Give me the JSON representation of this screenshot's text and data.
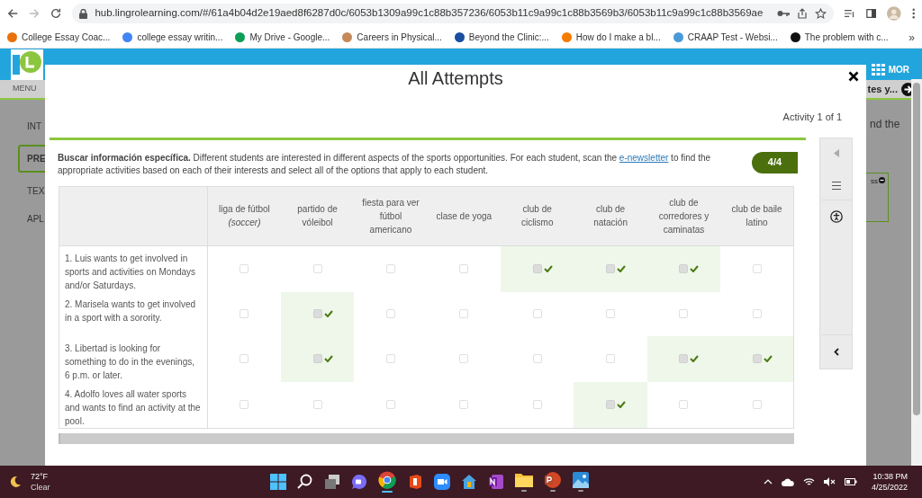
{
  "browser": {
    "url": "hub.lingrolearning.com/#/61a4b04d2e19aed8f6287d0c/6053b1309a99c1c88b357236/6053b11c9a99c1c88b3569b3/6053b11c9a99c1c88b3569ae",
    "bookmarks": [
      "College Essay Coac...",
      "college essay writin...",
      "My Drive - Google...",
      "Careers in Physical...",
      "Beyond the Clinic:...",
      "How do I make a bl...",
      "CRAAP Test - Websi...",
      "The problem with c..."
    ],
    "more": "»"
  },
  "app": {
    "menu": "MENU",
    "nav_right": "MOR",
    "breadcrumb": "tes y...",
    "content_text": "nd the",
    "panel_text": "ss",
    "sidebar_items": [
      {
        "label": "INT",
        "selected": false
      },
      {
        "label": "PRE",
        "selected": true
      },
      {
        "label": "TEX",
        "selected": false
      },
      {
        "label": "APL",
        "selected": false
      }
    ]
  },
  "modal": {
    "title": "All Attempts",
    "activity": "Activity 1 of 1",
    "instruction": {
      "lead": "Buscar información específica.",
      "before": "Different students are interested in different aspects of the sports opportunities. For each student, scan the",
      "link": "e-newsletter",
      "after": "to find the appropriate activities based on each of their interests and select all of the options that apply to each student."
    },
    "score": "4/4",
    "table": {
      "columns": [
        "liga de fútbol *(soccer)*",
        "partido de vóleibol",
        "fiesta para ver fútbol americano",
        "clase de yoga",
        "club de ciclismo",
        "club de natación",
        "club de corredores y caminatas",
        "club de baile latino"
      ],
      "rows": [
        {
          "label": "1. Luis wants to get involved in sports and activities on Mondays and/or Saturdays.",
          "cells": [
            {
              "checked": false
            },
            {
              "checked": false
            },
            {
              "checked": false
            },
            {
              "checked": false
            },
            {
              "checked": true
            },
            {
              "checked": true
            },
            {
              "checked": true
            },
            {
              "checked": false
            }
          ]
        },
        {
          "label": "2. Marisela wants to get involved in a sport with a sorority.",
          "cells": [
            {
              "checked": false
            },
            {
              "checked": true
            },
            {
              "checked": false
            },
            {
              "checked": false
            },
            {
              "checked": false
            },
            {
              "checked": false
            },
            {
              "checked": false
            },
            {
              "checked": false
            }
          ]
        },
        {
          "label": "3. Libertad is looking for something to do in the evenings, 6 p.m. or later.",
          "cells": [
            {
              "checked": false
            },
            {
              "checked": true
            },
            {
              "checked": false
            },
            {
              "checked": false
            },
            {
              "checked": false
            },
            {
              "checked": false
            },
            {
              "checked": true
            },
            {
              "checked": true
            }
          ]
        },
        {
          "label": "4. Adolfo loves all water sports and wants to find an activity at the pool.",
          "cells": [
            {
              "checked": false
            },
            {
              "checked": false
            },
            {
              "checked": false
            },
            {
              "checked": false
            },
            {
              "checked": false
            },
            {
              "checked": true
            },
            {
              "checked": false
            },
            {
              "checked": false
            }
          ]
        }
      ]
    }
  },
  "taskbar": {
    "temperature": "72°F",
    "condition": "Clear",
    "time": "10:38 PM",
    "date": "4/25/2022"
  }
}
